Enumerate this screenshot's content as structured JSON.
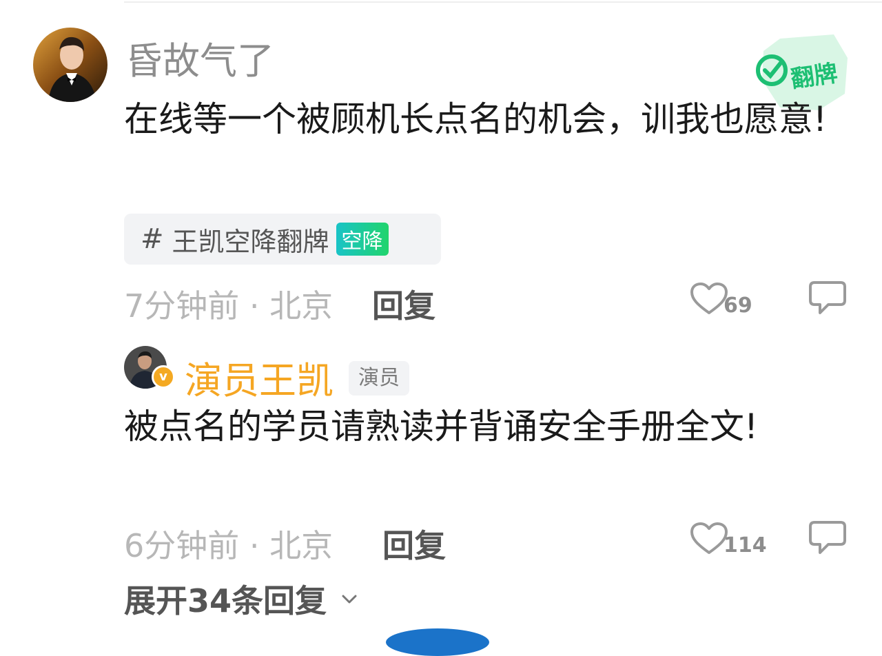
{
  "comment": {
    "username": "昏故气了",
    "text": "在线等一个被顾机长点名的机会，训我也愿意!",
    "topic": {
      "hash": "#",
      "label": "王凯空降翻牌",
      "badge": "空降"
    },
    "flip_stamp_text": "翻牌",
    "time_location": "7分钟前 · 北京",
    "reply_label": "回复",
    "likes": "69",
    "avatar_icon": "user-avatar-man-in-tuxedo"
  },
  "reply": {
    "username": "演员王凯",
    "role_tag": "演员",
    "verified_mark": "v",
    "text": "被点名的学员请熟读并背诵安全手册全文!",
    "time_location": "6分钟前 · 北京",
    "reply_label": "回复",
    "likes": "114",
    "avatar_icon": "user-avatar-man-in-suit"
  },
  "expand_label": "展开34条回复",
  "colors": {
    "username_primary": "#8d8d8d",
    "username_verified": "#f5a623",
    "text": "#1a1a1a",
    "meta": "#b7b7b7",
    "badge_gradient_start": "#19c3c7",
    "badge_gradient_end": "#21d46c",
    "stamp_green": "#1dbf73"
  }
}
